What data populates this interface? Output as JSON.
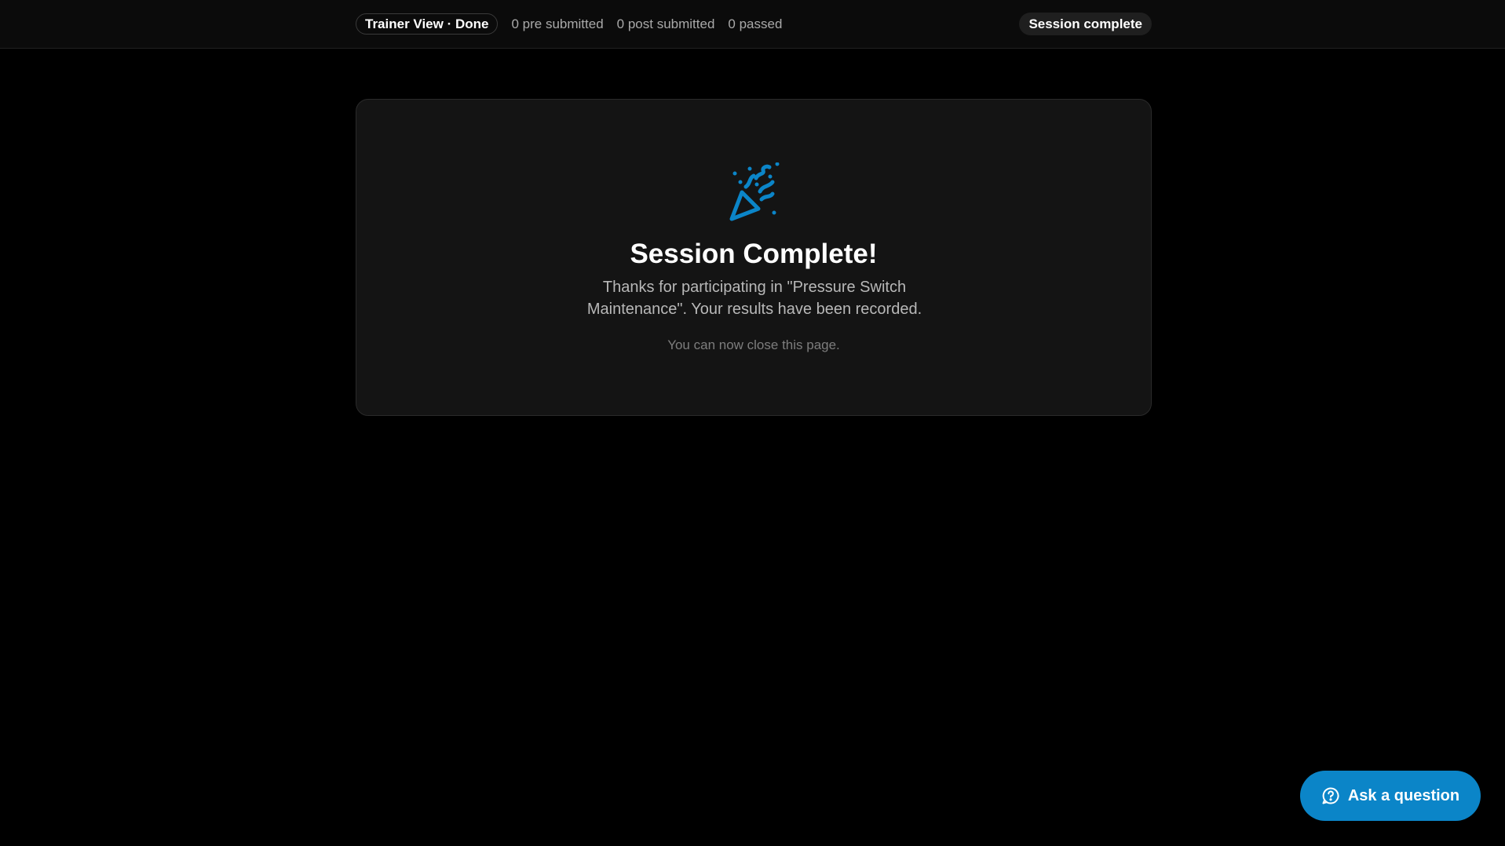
{
  "header": {
    "mode_label": "Trainer View · Done",
    "stats": {
      "pre_submitted": "0 pre submitted",
      "post_submitted": "0 post submitted",
      "passed": "0 passed"
    },
    "status_label": "Session complete"
  },
  "completion": {
    "icon": "party-popper-icon",
    "title": "Session Complete!",
    "message": "Thanks for participating in \"Pressure Switch Maintenance\". Your results have been recorded.",
    "note": "You can now close this page."
  },
  "help_button": {
    "icon": "help-circle-icon",
    "label": "Ask a question"
  },
  "colors": {
    "accent": "#0b85c8",
    "background": "#000000",
    "card": "#141414"
  }
}
